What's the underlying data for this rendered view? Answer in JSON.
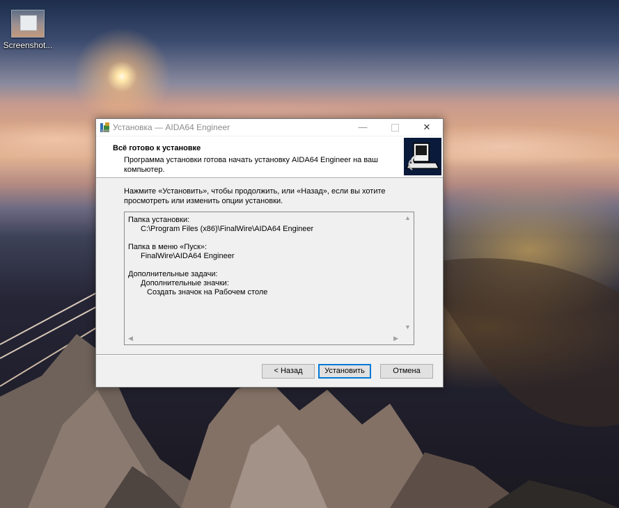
{
  "desktop": {
    "icon_label": "Screenshot..."
  },
  "window": {
    "title": "Установка — AIDA64 Engineer",
    "caption_buttons": {
      "minimize": "—",
      "close": "✕"
    },
    "header": {
      "title": "Всё готово к установке",
      "subtitle": "Программа установки готова начать установку AIDA64 Engineer на ваш компьютер."
    },
    "intro": "Нажмите «Установить», чтобы продолжить, или «Назад», если вы хотите просмотреть или изменить опции установки.",
    "memo": {
      "install_folder_label": "Папка установки:",
      "install_folder_value": "C:\\Program Files (x86)\\FinalWire\\AIDA64 Engineer",
      "start_menu_label": "Папка в меню «Пуск»:",
      "start_menu_value": "FinalWire\\AIDA64 Engineer",
      "tasks_label": "Дополнительные задачи:",
      "tasks_group": "Дополнительные значки:",
      "tasks_item": "Создать значок на Рабочем столе"
    },
    "buttons": {
      "back": "< Назад",
      "install": "Установить",
      "cancel": "Отмена"
    }
  },
  "colors": {
    "window_bg": "#f0f0f0",
    "focus_border": "#0078d7"
  }
}
